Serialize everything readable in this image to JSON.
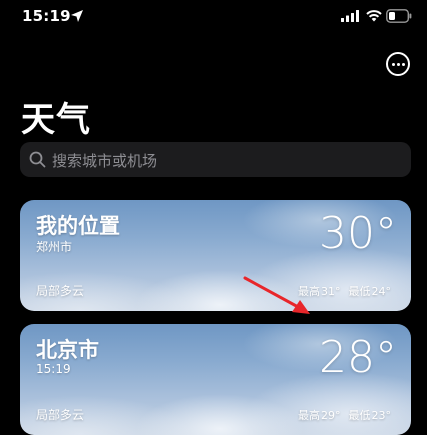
{
  "status_bar": {
    "time": "15:19"
  },
  "header": {
    "title": "天气"
  },
  "search": {
    "placeholder": "搜索城市或机场"
  },
  "cities": [
    {
      "name": "我的位置",
      "subtitle": "郑州市",
      "temperature": "30°",
      "condition": "局部多云",
      "high_label": "最高",
      "high": "31°",
      "low_label": "最低",
      "low": "24°"
    },
    {
      "name": "北京市",
      "subtitle": "15:19",
      "temperature": "28°",
      "condition": "局部多云",
      "high_label": "最高",
      "high": "29°",
      "low_label": "最低",
      "low": "23°"
    }
  ],
  "colors": {
    "background": "#000000",
    "search_bg": "#1c1c1e",
    "placeholder": "#8e8e93",
    "annotation_arrow": "#e8262a"
  },
  "icons": [
    "location-arrow-icon",
    "signal-icon",
    "wifi-icon",
    "battery-icon",
    "more-icon",
    "search-icon"
  ]
}
